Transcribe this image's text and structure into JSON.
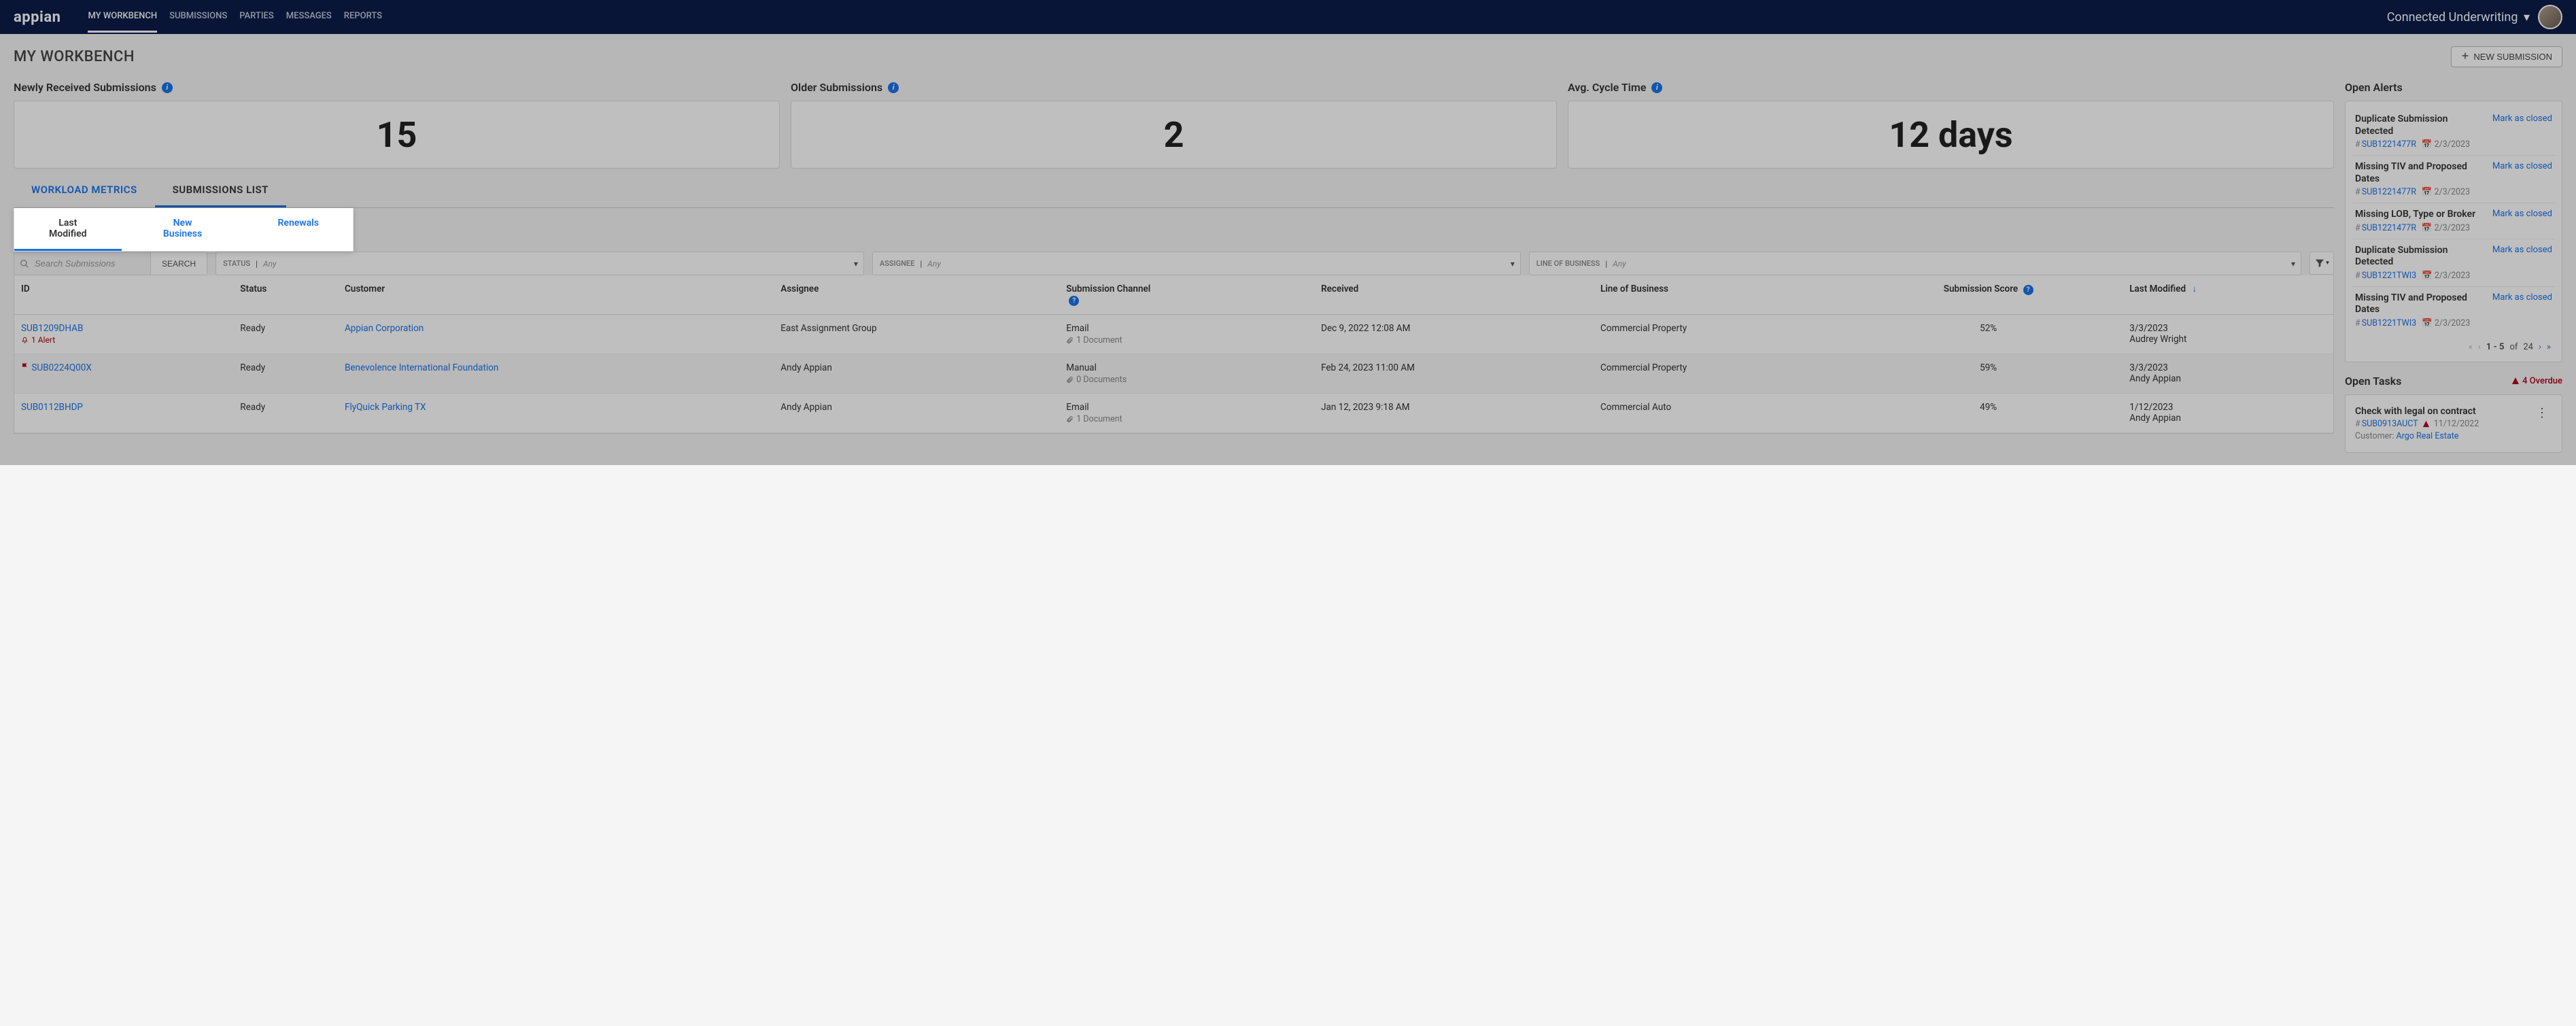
{
  "topnav": {
    "logo": "appian",
    "items": [
      "MY WORKBENCH",
      "SUBMISSIONS",
      "PARTIES",
      "MESSAGES",
      "REPORTS"
    ],
    "appName": "Connected Underwriting"
  },
  "page": {
    "title": "MY WORKBENCH",
    "newSubmissionLabel": "NEW SUBMISSION"
  },
  "kpis": {
    "newly": {
      "label": "Newly Received Submissions",
      "value": "15"
    },
    "older": {
      "label": "Older Submissions",
      "value": "2"
    },
    "cycle": {
      "label": "Avg. Cycle Time",
      "value": "12 days"
    }
  },
  "tabs1": {
    "workload": "WORKLOAD METRICS",
    "submissions": "SUBMISSIONS LIST"
  },
  "tabs2": {
    "lastModified": "Last Modified",
    "newBusiness": "New Business",
    "renewals": "Renewals"
  },
  "filters": {
    "searchPlaceholder": "Search Submissions",
    "searchBtn": "SEARCH",
    "statusLabel": "STATUS",
    "assigneeLabel": "ASSIGNEE",
    "lobLabel": "LINE OF BUSINESS",
    "anyText": "Any"
  },
  "columns": {
    "id": "ID",
    "status": "Status",
    "customer": "Customer",
    "assignee": "Assignee",
    "channel": "Submission Channel",
    "received": "Received",
    "lob": "Line of Business",
    "score": "Submission Score",
    "lastModified": "Last Modified"
  },
  "rows": [
    {
      "id": "SUB1209DHAB",
      "alertText": "1 Alert",
      "flag": false,
      "alert": true,
      "status": "Ready",
      "customer": "Appian Corporation",
      "assignee": "East Assignment Group",
      "channel": "Email",
      "docs": "1 Document",
      "received": "Dec 9, 2022 12:08 AM",
      "lob": "Commercial Property",
      "score": "52%",
      "lmDate": "3/3/2023",
      "lmBy": "Audrey Wright"
    },
    {
      "id": "SUB0224Q00X",
      "flag": true,
      "alert": false,
      "status": "Ready",
      "customer": "Benevolence International Foundation",
      "assignee": "Andy Appian",
      "channel": "Manual",
      "docs": "0 Documents",
      "received": "Feb 24, 2023 11:00 AM",
      "lob": "Commercial Property",
      "score": "59%",
      "lmDate": "3/3/2023",
      "lmBy": "Andy Appian"
    },
    {
      "id": "SUB0112BHDP",
      "flag": false,
      "alert": false,
      "status": "Ready",
      "customer": "FlyQuick Parking TX",
      "assignee": "Andy Appian",
      "channel": "Email",
      "docs": "1 Document",
      "received": "Jan 12, 2023 9:18 AM",
      "lob": "Commercial Auto",
      "score": "49%",
      "lmDate": "1/12/2023",
      "lmBy": "Andy Appian"
    }
  ],
  "alertsPanel": {
    "title": "Open Alerts",
    "markLabel": "Mark as closed",
    "items": [
      {
        "title": "Duplicate Submission Detected",
        "sub": "SUB1221477R",
        "date": "2/3/2023"
      },
      {
        "title": "Missing TIV and Proposed Dates",
        "sub": "SUB1221477R",
        "date": "2/3/2023"
      },
      {
        "title": "Missing LOB, Type or Broker",
        "sub": "SUB1221477R",
        "date": "2/3/2023"
      },
      {
        "title": "Duplicate Submission Detected",
        "sub": "SUB1221TWI3",
        "date": "2/3/2023"
      },
      {
        "title": "Missing TIV and Proposed Dates",
        "sub": "SUB1221TWI3",
        "date": "2/3/2023"
      }
    ],
    "pager": {
      "range": "1 - 5",
      "of": "of",
      "total": "24"
    }
  },
  "tasksPanel": {
    "title": "Open Tasks",
    "overdue": "4 Overdue",
    "items": [
      {
        "title": "Check with legal on contract",
        "sub": "SUB0913AUCT",
        "date": "11/12/2022",
        "customerLabel": "Customer:",
        "customer": "Argo Real Estate"
      }
    ]
  }
}
